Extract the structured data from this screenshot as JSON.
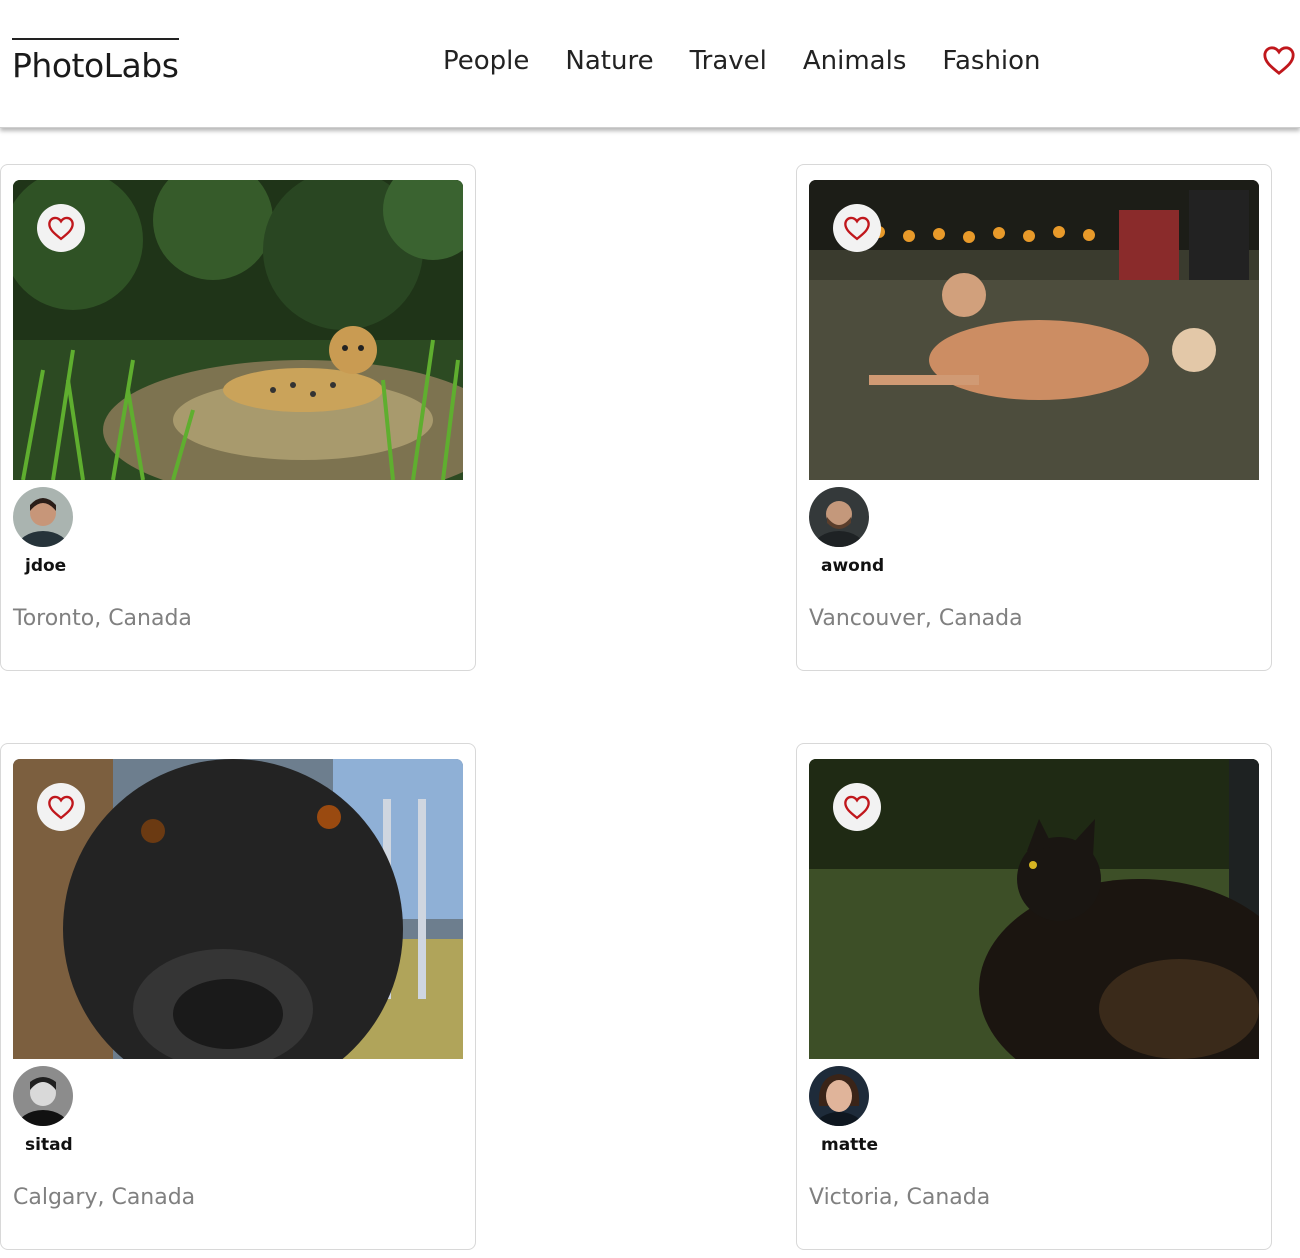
{
  "app": {
    "logo": "PhotoLabs"
  },
  "nav": {
    "topics": [
      "People",
      "Nature",
      "Travel",
      "Animals",
      "Fashion"
    ],
    "fav_icon": "heart-outline-icon"
  },
  "colors": {
    "heart": "#c0171c",
    "location_text": "#808080",
    "card_border": "#d8d8d8"
  },
  "photos": [
    {
      "username": "jdoe",
      "location": "Toronto, Canada",
      "subject": "jaguar in tall grass"
    },
    {
      "username": "awond",
      "location": "Vancouver, Canada",
      "subject": "dog lying on lawn"
    },
    {
      "username": "sitad",
      "location": "Calgary, Canada",
      "subject": "black dog close-up"
    },
    {
      "username": "matte",
      "location": "Victoria, Canada",
      "subject": "black cat looking up"
    }
  ]
}
